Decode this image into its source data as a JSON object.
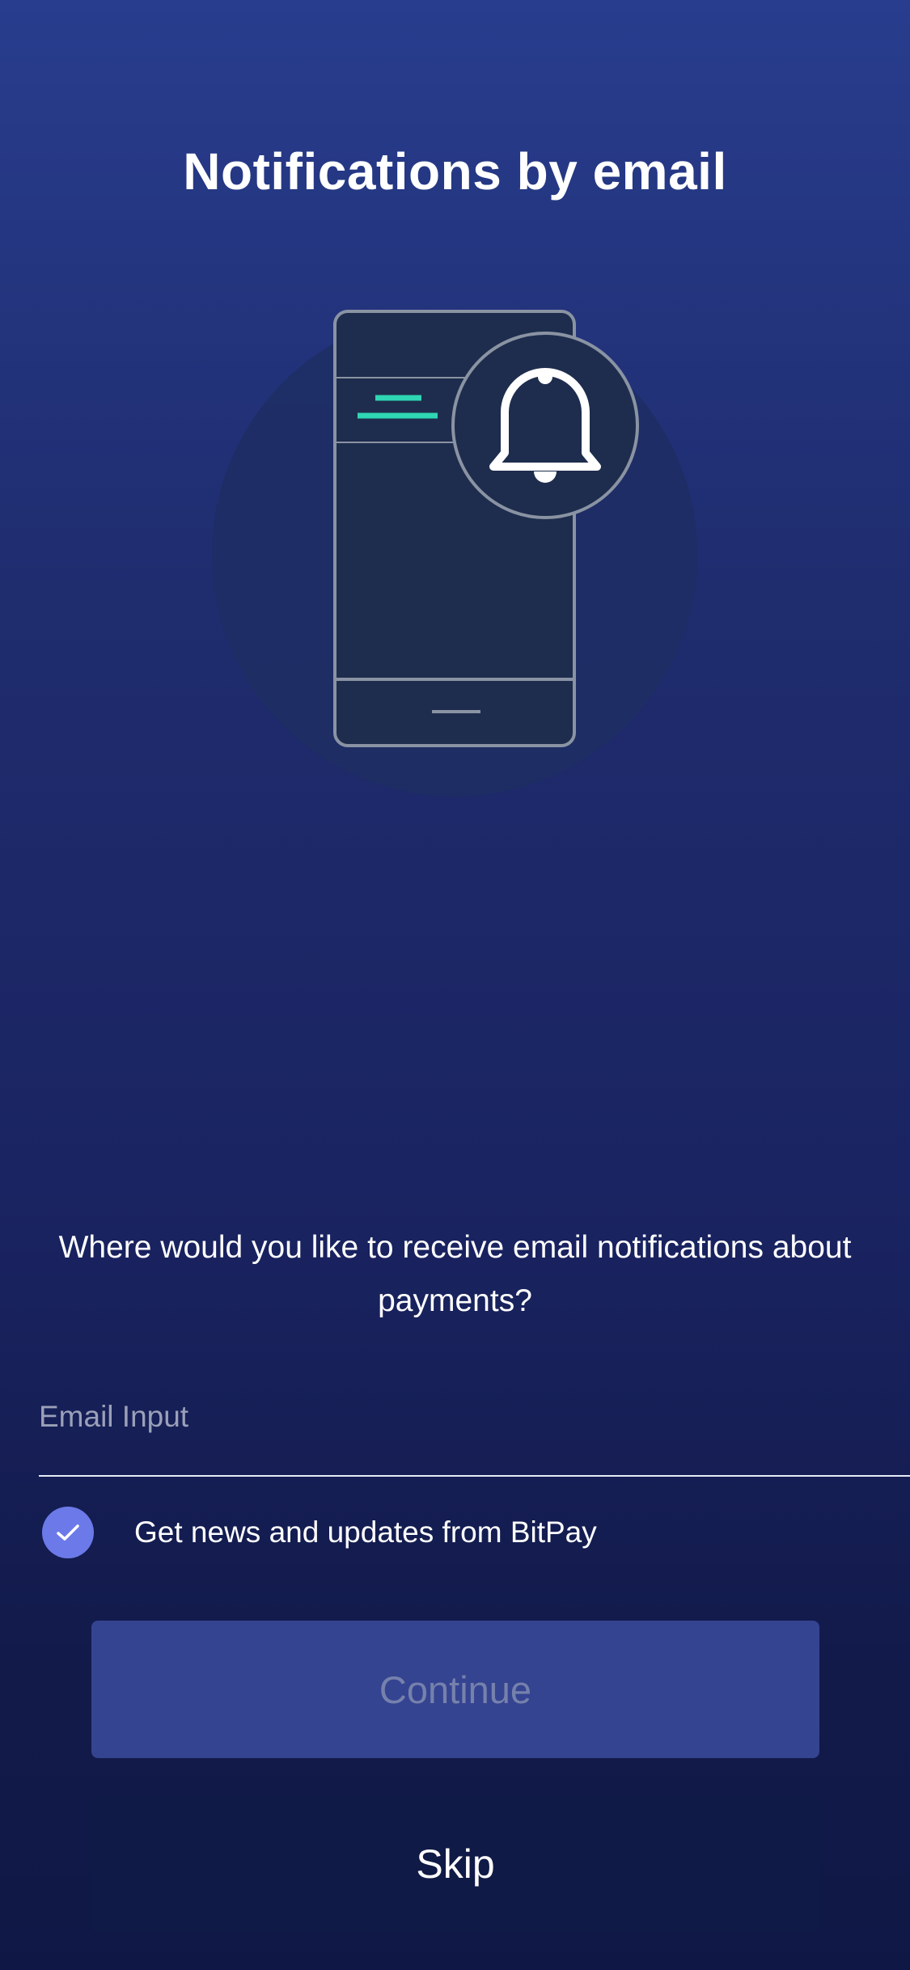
{
  "header": {
    "title": "Notifications by email"
  },
  "illustration": {
    "icons": [
      "phone-icon",
      "bell-icon"
    ],
    "accent_color": "#2fd6b3"
  },
  "form": {
    "question": "Where would you like to receive email notifications about payments?",
    "email_placeholder": "Email Input",
    "email_value": "",
    "news_checkbox_label": "Get news and updates from BitPay",
    "news_checkbox_checked": true
  },
  "actions": {
    "continue_label": "Continue",
    "skip_label": "Skip"
  },
  "colors": {
    "checkbox": "#6b7ae8",
    "continue_bg": "#354491",
    "continue_text": "#7681ac"
  }
}
